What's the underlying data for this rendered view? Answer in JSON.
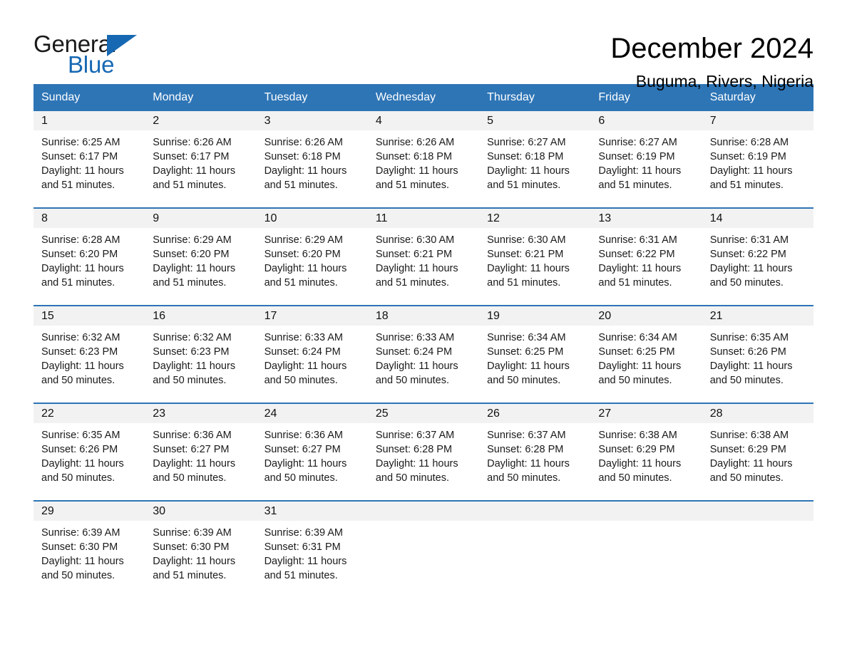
{
  "brand": {
    "name_part1": "General",
    "name_part2": "Blue",
    "flag_icon": "triangle-flag-icon",
    "accent_color": "#1668b3"
  },
  "header": {
    "title": "December 2024",
    "location": "Buguma, Rivers, Nigeria"
  },
  "colors": {
    "header_blue": "#2e75b6",
    "daynum_strip": "#f2f2f2",
    "row_divider": "#2e75b6"
  },
  "weekdays": [
    "Sunday",
    "Monday",
    "Tuesday",
    "Wednesday",
    "Thursday",
    "Friday",
    "Saturday"
  ],
  "labels": {
    "sunrise_prefix": "Sunrise:",
    "sunset_prefix": "Sunset:",
    "daylight_prefix": "Daylight:"
  },
  "weeks": [
    [
      {
        "day": "1",
        "sunrise": "Sunrise: 6:25 AM",
        "sunset": "Sunset: 6:17 PM",
        "daylight": "Daylight: 11 hours and 51 minutes."
      },
      {
        "day": "2",
        "sunrise": "Sunrise: 6:26 AM",
        "sunset": "Sunset: 6:17 PM",
        "daylight": "Daylight: 11 hours and 51 minutes."
      },
      {
        "day": "3",
        "sunrise": "Sunrise: 6:26 AM",
        "sunset": "Sunset: 6:18 PM",
        "daylight": "Daylight: 11 hours and 51 minutes."
      },
      {
        "day": "4",
        "sunrise": "Sunrise: 6:26 AM",
        "sunset": "Sunset: 6:18 PM",
        "daylight": "Daylight: 11 hours and 51 minutes."
      },
      {
        "day": "5",
        "sunrise": "Sunrise: 6:27 AM",
        "sunset": "Sunset: 6:18 PM",
        "daylight": "Daylight: 11 hours and 51 minutes."
      },
      {
        "day": "6",
        "sunrise": "Sunrise: 6:27 AM",
        "sunset": "Sunset: 6:19 PM",
        "daylight": "Daylight: 11 hours and 51 minutes."
      },
      {
        "day": "7",
        "sunrise": "Sunrise: 6:28 AM",
        "sunset": "Sunset: 6:19 PM",
        "daylight": "Daylight: 11 hours and 51 minutes."
      }
    ],
    [
      {
        "day": "8",
        "sunrise": "Sunrise: 6:28 AM",
        "sunset": "Sunset: 6:20 PM",
        "daylight": "Daylight: 11 hours and 51 minutes."
      },
      {
        "day": "9",
        "sunrise": "Sunrise: 6:29 AM",
        "sunset": "Sunset: 6:20 PM",
        "daylight": "Daylight: 11 hours and 51 minutes."
      },
      {
        "day": "10",
        "sunrise": "Sunrise: 6:29 AM",
        "sunset": "Sunset: 6:20 PM",
        "daylight": "Daylight: 11 hours and 51 minutes."
      },
      {
        "day": "11",
        "sunrise": "Sunrise: 6:30 AM",
        "sunset": "Sunset: 6:21 PM",
        "daylight": "Daylight: 11 hours and 51 minutes."
      },
      {
        "day": "12",
        "sunrise": "Sunrise: 6:30 AM",
        "sunset": "Sunset: 6:21 PM",
        "daylight": "Daylight: 11 hours and 51 minutes."
      },
      {
        "day": "13",
        "sunrise": "Sunrise: 6:31 AM",
        "sunset": "Sunset: 6:22 PM",
        "daylight": "Daylight: 11 hours and 51 minutes."
      },
      {
        "day": "14",
        "sunrise": "Sunrise: 6:31 AM",
        "sunset": "Sunset: 6:22 PM",
        "daylight": "Daylight: 11 hours and 50 minutes."
      }
    ],
    [
      {
        "day": "15",
        "sunrise": "Sunrise: 6:32 AM",
        "sunset": "Sunset: 6:23 PM",
        "daylight": "Daylight: 11 hours and 50 minutes."
      },
      {
        "day": "16",
        "sunrise": "Sunrise: 6:32 AM",
        "sunset": "Sunset: 6:23 PM",
        "daylight": "Daylight: 11 hours and 50 minutes."
      },
      {
        "day": "17",
        "sunrise": "Sunrise: 6:33 AM",
        "sunset": "Sunset: 6:24 PM",
        "daylight": "Daylight: 11 hours and 50 minutes."
      },
      {
        "day": "18",
        "sunrise": "Sunrise: 6:33 AM",
        "sunset": "Sunset: 6:24 PM",
        "daylight": "Daylight: 11 hours and 50 minutes."
      },
      {
        "day": "19",
        "sunrise": "Sunrise: 6:34 AM",
        "sunset": "Sunset: 6:25 PM",
        "daylight": "Daylight: 11 hours and 50 minutes."
      },
      {
        "day": "20",
        "sunrise": "Sunrise: 6:34 AM",
        "sunset": "Sunset: 6:25 PM",
        "daylight": "Daylight: 11 hours and 50 minutes."
      },
      {
        "day": "21",
        "sunrise": "Sunrise: 6:35 AM",
        "sunset": "Sunset: 6:26 PM",
        "daylight": "Daylight: 11 hours and 50 minutes."
      }
    ],
    [
      {
        "day": "22",
        "sunrise": "Sunrise: 6:35 AM",
        "sunset": "Sunset: 6:26 PM",
        "daylight": "Daylight: 11 hours and 50 minutes."
      },
      {
        "day": "23",
        "sunrise": "Sunrise: 6:36 AM",
        "sunset": "Sunset: 6:27 PM",
        "daylight": "Daylight: 11 hours and 50 minutes."
      },
      {
        "day": "24",
        "sunrise": "Sunrise: 6:36 AM",
        "sunset": "Sunset: 6:27 PM",
        "daylight": "Daylight: 11 hours and 50 minutes."
      },
      {
        "day": "25",
        "sunrise": "Sunrise: 6:37 AM",
        "sunset": "Sunset: 6:28 PM",
        "daylight": "Daylight: 11 hours and 50 minutes."
      },
      {
        "day": "26",
        "sunrise": "Sunrise: 6:37 AM",
        "sunset": "Sunset: 6:28 PM",
        "daylight": "Daylight: 11 hours and 50 minutes."
      },
      {
        "day": "27",
        "sunrise": "Sunrise: 6:38 AM",
        "sunset": "Sunset: 6:29 PM",
        "daylight": "Daylight: 11 hours and 50 minutes."
      },
      {
        "day": "28",
        "sunrise": "Sunrise: 6:38 AM",
        "sunset": "Sunset: 6:29 PM",
        "daylight": "Daylight: 11 hours and 50 minutes."
      }
    ],
    [
      {
        "day": "29",
        "sunrise": "Sunrise: 6:39 AM",
        "sunset": "Sunset: 6:30 PM",
        "daylight": "Daylight: 11 hours and 50 minutes."
      },
      {
        "day": "30",
        "sunrise": "Sunrise: 6:39 AM",
        "sunset": "Sunset: 6:30 PM",
        "daylight": "Daylight: 11 hours and 51 minutes."
      },
      {
        "day": "31",
        "sunrise": "Sunrise: 6:39 AM",
        "sunset": "Sunset: 6:31 PM",
        "daylight": "Daylight: 11 hours and 51 minutes."
      },
      {
        "day": "",
        "sunrise": "",
        "sunset": "",
        "daylight": ""
      },
      {
        "day": "",
        "sunrise": "",
        "sunset": "",
        "daylight": ""
      },
      {
        "day": "",
        "sunrise": "",
        "sunset": "",
        "daylight": ""
      },
      {
        "day": "",
        "sunrise": "",
        "sunset": "",
        "daylight": ""
      }
    ]
  ]
}
